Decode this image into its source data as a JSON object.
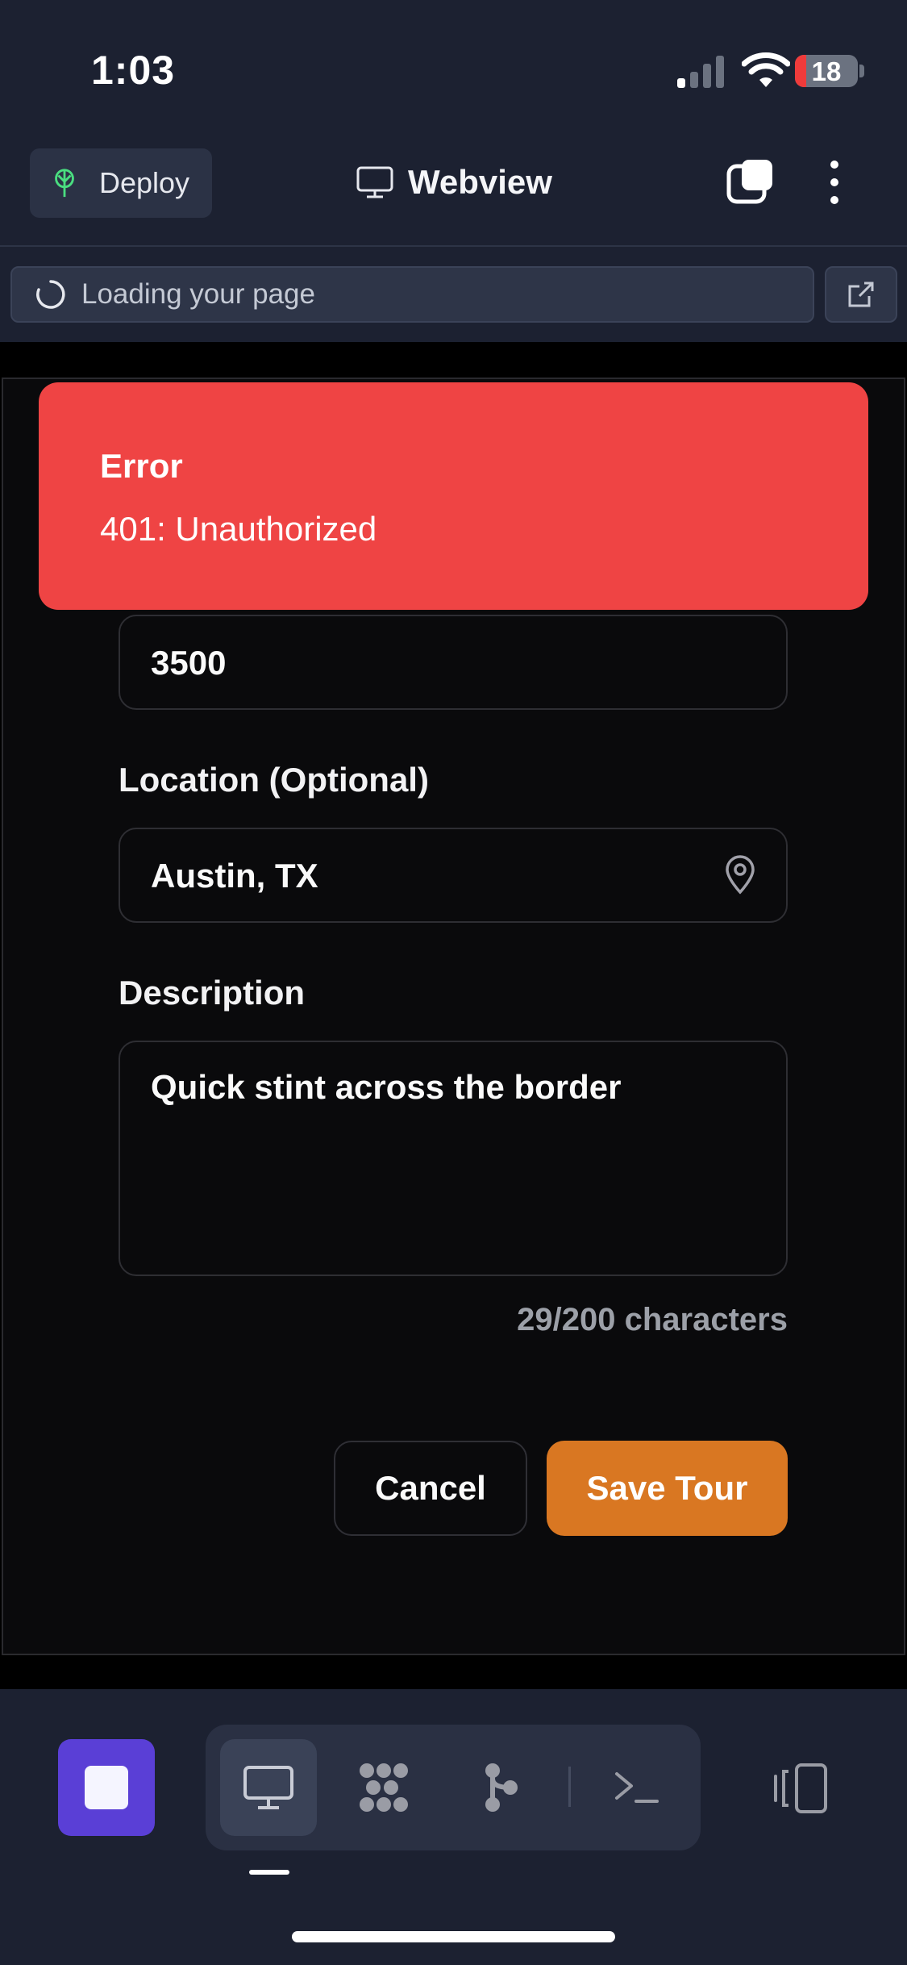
{
  "status_bar": {
    "time": "1:03",
    "battery_level": "18",
    "battery_color": "#ef3b3b",
    "icons": [
      "signal-icon",
      "wifi-icon",
      "battery-icon"
    ]
  },
  "top_bar": {
    "deploy_label": "Deploy",
    "title": "Webview",
    "icons": [
      "deploy-icon",
      "monitor-icon",
      "tabs-icon",
      "more-vertical-icon"
    ]
  },
  "url_bar": {
    "loading_text": "Loading your page",
    "icons": [
      "spinner-icon",
      "external-link-icon"
    ]
  },
  "error_toast": {
    "title": "Error",
    "message": "401: Unauthorized",
    "color": "#ef4444"
  },
  "form": {
    "amount_value": "3500",
    "location_label": "Location (Optional)",
    "location_value": "Austin, TX",
    "description_label": "Description",
    "description_value": "Quick stint across the border",
    "char_count": "29/200 characters",
    "cancel_label": "Cancel",
    "save_label": "Save Tour",
    "accent_color": "#d97722"
  },
  "bottom_toolbar": {
    "tools": [
      "stop-icon",
      "monitor-icon",
      "dots-grid-icon",
      "git-branch-icon",
      "terminal-icon",
      "devices-icon"
    ],
    "active_tool": "monitor-icon",
    "stop_color": "#5a3fd6"
  }
}
